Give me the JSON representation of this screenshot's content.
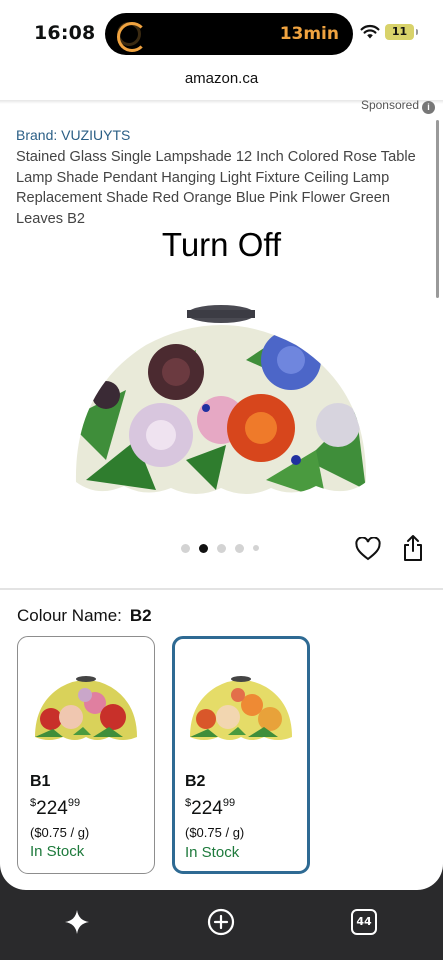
{
  "status_bar": {
    "time": "16:08",
    "timer_text": "13min",
    "battery": "11",
    "accent": "#f0a340"
  },
  "browser": {
    "url": "amazon.ca"
  },
  "ad": {
    "sponsored": "Sponsored",
    "info_icon": "i"
  },
  "product": {
    "brand": "Brand: VUZIUYTS",
    "title": "Stained Glass Single Lampshade 12 Inch Colored Rose Table Lamp Shade Pendant Hanging Light Fixture Ceiling Lamp Replacement Shade Red Orange Blue Pink Flower Green Leaves B2",
    "overlay_text": "Turn Off",
    "image_dots": {
      "count": 5,
      "active_index": 1
    }
  },
  "variants": {
    "label": "Colour Name:",
    "selected": "B2",
    "items": [
      {
        "name": "B1",
        "price_symbol": "$",
        "price_whole": "224",
        "price_fraction": "99",
        "unit_price": "($0.75 / g)",
        "stock": "In Stock",
        "selected": false
      },
      {
        "name": "B2",
        "price_symbol": "$",
        "price_whole": "224",
        "price_fraction": "99",
        "unit_price": "($0.75 / g)",
        "stock": "In Stock",
        "selected": true
      }
    ]
  },
  "toolbar": {
    "tabs_count": "44"
  },
  "colors": {
    "brand_link": "#2b5f86",
    "in_stock": "#1e7a3c",
    "selected_border": "#2e6a93"
  }
}
